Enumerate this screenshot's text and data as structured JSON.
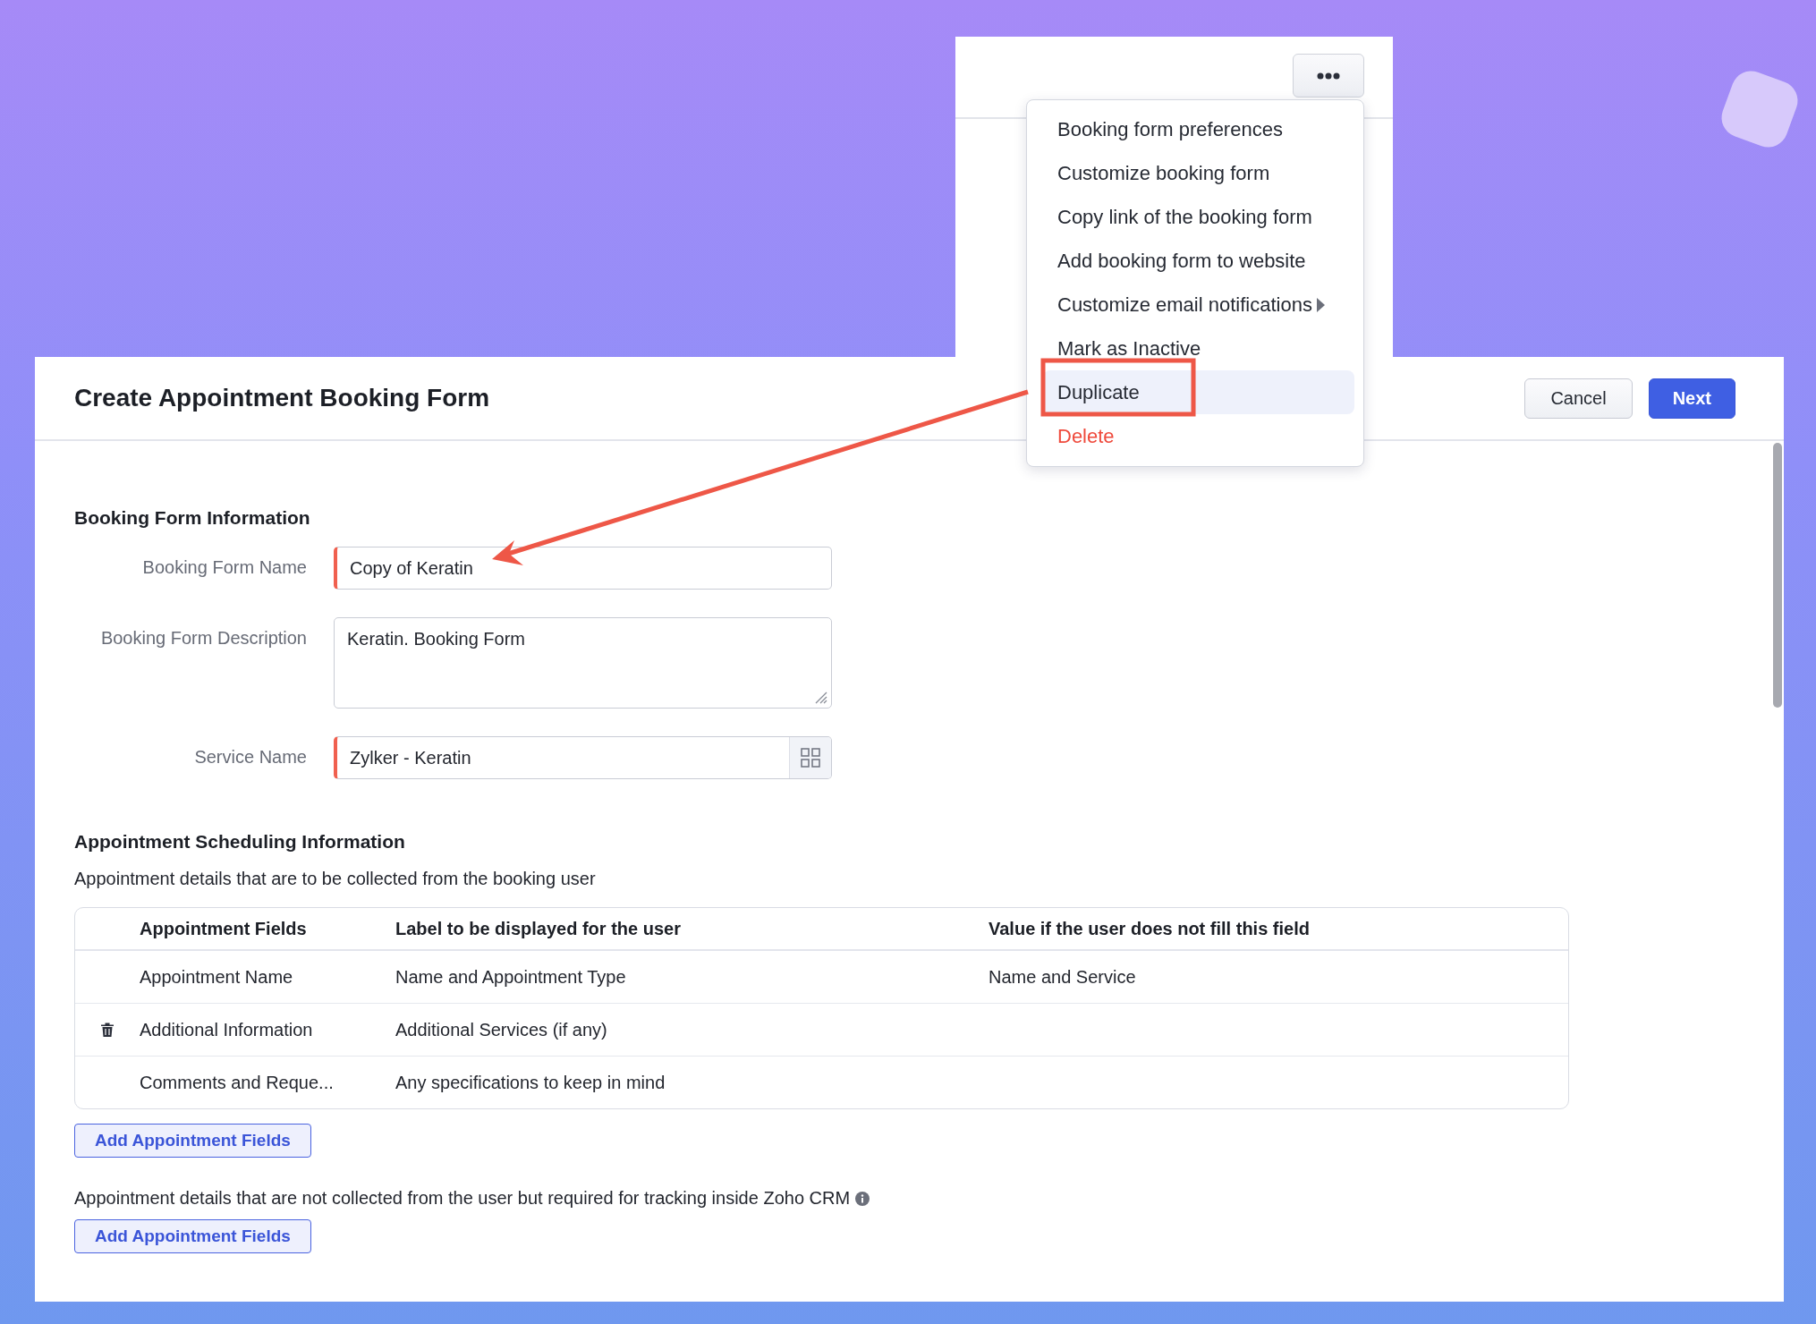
{
  "menu": {
    "items": [
      {
        "label": "Booking form preferences",
        "kind": "normal",
        "selected": false
      },
      {
        "label": "Customize booking form",
        "kind": "normal",
        "selected": false
      },
      {
        "label": "Copy link of the booking form",
        "kind": "normal",
        "selected": false
      },
      {
        "label": "Add booking form to website",
        "kind": "normal",
        "selected": false
      },
      {
        "label": "Customize email notifications",
        "kind": "submenu",
        "selected": false
      },
      {
        "label": "Mark as Inactive",
        "kind": "normal",
        "selected": false
      },
      {
        "label": "Duplicate",
        "kind": "normal",
        "selected": true
      },
      {
        "label": "Delete",
        "kind": "danger",
        "selected": false
      }
    ]
  },
  "dialog": {
    "title": "Create Appointment Booking Form",
    "buttons": [
      {
        "label": "Cancel",
        "kind": "secondary"
      },
      {
        "label": "Next",
        "kind": "primary"
      }
    ],
    "booking_form_information": {
      "title": "Booking Form Information",
      "fields": [
        {
          "label": "Booking Form Name",
          "value": "Copy of Keratin",
          "kind": "text",
          "required": true
        },
        {
          "label": "Booking Form Description",
          "value": "Keratin. Booking Form",
          "kind": "textarea",
          "required": false
        },
        {
          "label": "Service Name",
          "value": "Zylker - Keratin",
          "kind": "lookup",
          "required": true
        }
      ]
    },
    "appointment_scheduling_information": {
      "title": "Appointment Scheduling Information",
      "subtitle": "Appointment details that are to be collected from the booking user",
      "table": {
        "columns": [
          "Appointment Fields",
          "Label to be displayed for the user",
          "Value if the user does not fill this field"
        ],
        "rows": [
          {
            "field": "Appointment Name",
            "label": "Name and Appointment Type",
            "default_value": "Name and Service",
            "show_delete": false
          },
          {
            "field": "Additional Information",
            "label": "Additional Services (if any)",
            "show_delete": true
          },
          {
            "field": "Comments and Reque...",
            "label": "Any specifications to keep in mind",
            "show_delete": false
          }
        ]
      },
      "add_button": "Add Appointment Fields"
    },
    "tracking": {
      "text": "Appointment details that are not collected from the user but required for tracking inside Zoho CRM",
      "add_button": "Add Appointment Fields"
    }
  }
}
